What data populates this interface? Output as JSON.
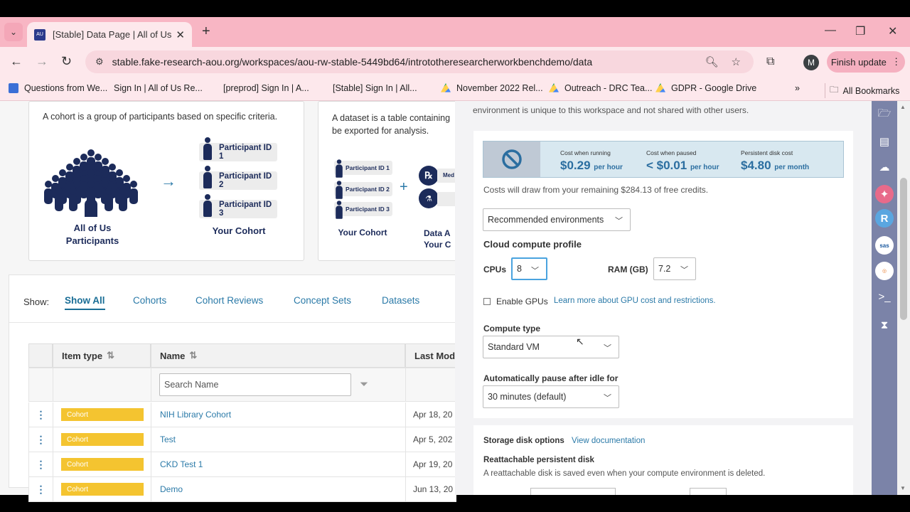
{
  "browser": {
    "tab_title": "[Stable] Data Page | All of Us Re",
    "url": "stable.fake-research-aou.org/workspaces/aou-rw-stable-5449bd64/intrototheresearcherworkbenchdemo/data",
    "finish_update": "Finish update",
    "avatar_letter": "M",
    "bookmarks": [
      "Questions from We...",
      "Sign In | All of Us Re...",
      "[preprod] Sign In | A...",
      "[Stable] Sign In | All...",
      "November 2022 Rel...",
      "Outreach - DRC Tea...",
      "GDPR - Google Drive"
    ],
    "all_bookmarks": "All Bookmarks",
    "tab_fav_text": "AU"
  },
  "cohort_card": {
    "desc": "A cohort is a group of participants based on specific criteria.",
    "crowd_label": "All of Us Participants",
    "ids": [
      "Participant ID 1",
      "Participant ID 2",
      "Participant ID 3"
    ],
    "your_cohort": "Your Cohort"
  },
  "dataset_card": {
    "desc": "A dataset is a table containing be exported for analysis.",
    "ids": [
      "Participant ID 1",
      "Participant ID 2",
      "Participant ID 3"
    ],
    "your_cohort": "Your Cohort",
    "data_label": "Data A Your C",
    "med_label": "Med"
  },
  "filter": {
    "show": "Show:",
    "tabs": [
      "Show All",
      "Cohorts",
      "Cohort Reviews",
      "Concept Sets",
      "Datasets"
    ]
  },
  "table": {
    "headers": [
      "Item type",
      "Name",
      "Last Mod"
    ],
    "search_placeholder": "Search Name",
    "rows": [
      {
        "type": "Cohort",
        "name": "NIH Library Cohort",
        "date": "Apr 18, 20"
      },
      {
        "type": "Cohort",
        "name": "Test",
        "date": "Apr 5, 202"
      },
      {
        "type": "Cohort",
        "name": "CKD Test 1",
        "date": "Apr 19, 20"
      },
      {
        "type": "Cohort",
        "name": "Demo",
        "date": "Jun 13, 20"
      }
    ]
  },
  "panel": {
    "top_text": "environment is unique to this workspace and not shared with other users.",
    "costs": [
      {
        "label": "Cost when running",
        "value": "$0.29",
        "unit": "per hour"
      },
      {
        "label": "Cost when paused",
        "value": "< $0.01",
        "unit": "per hour"
      },
      {
        "label": "Persistent disk cost",
        "value": "$4.80",
        "unit": "per month"
      }
    ],
    "credits_text": "Costs will draw from your remaining $284.13 of free credits.",
    "env_select": "Recommended environments",
    "profile_title": "Cloud compute profile",
    "cpus_label": "CPUs",
    "cpus_value": "8",
    "ram_label": "RAM (GB)",
    "ram_value": "7.2",
    "gpu_label": "Enable GPUs",
    "gpu_link": "Learn more about GPU cost and restrictions.",
    "compute_type_label": "Compute type",
    "compute_type_value": "Standard VM",
    "autopause_label": "Automatically pause after idle for",
    "autopause_value": "30 minutes (default)",
    "storage_title": "Storage disk options",
    "storage_link": "View documentation",
    "reattach_title": "Reattachable persistent disk",
    "reattach_desc": "A reattachable disk is saved even when your compute environment is deleted."
  },
  "rail_icons": [
    "folder-icon",
    "notebook-icon",
    "cloud-icon",
    "cromwell-icon",
    "r-icon",
    "sas-icon",
    "jupyter-icon",
    "terminal-icon",
    "hourglass-icon"
  ]
}
